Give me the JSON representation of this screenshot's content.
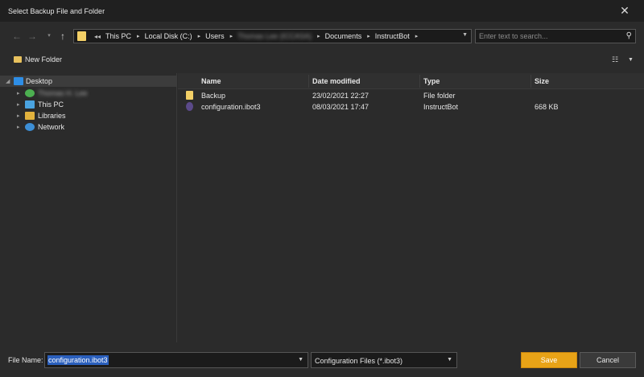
{
  "window": {
    "title": "Select Backup File and Folder"
  },
  "nav": {
    "back": "←",
    "forward": "→",
    "recent": "▾",
    "up": "↑"
  },
  "address": {
    "crumbs": [
      "This PC",
      "Local Disk (C:)",
      "Users",
      "Thomas Lee (ICCASA)",
      "Documents",
      "InstructBot"
    ]
  },
  "search": {
    "placeholder": "Enter text to search..."
  },
  "toolbar": {
    "new_folder": "New Folder"
  },
  "tree": {
    "items": [
      {
        "label": "Desktop",
        "icon": "desktop-icon",
        "color": "#2e8ee6"
      },
      {
        "label": "Thomas H. Lee",
        "icon": "user-icon",
        "color": "#4caf50"
      },
      {
        "label": "This PC",
        "icon": "computer-icon",
        "color": "#4aa3e0"
      },
      {
        "label": "Libraries",
        "icon": "libraries-icon",
        "color": "#e2b23d"
      },
      {
        "label": "Network",
        "icon": "network-icon",
        "color": "#3d8fd6"
      }
    ]
  },
  "files": {
    "columns": [
      "Name",
      "Date modified",
      "Type",
      "Size"
    ],
    "rows": [
      {
        "name": "Backup",
        "date": "23/02/2021 22:27",
        "type": "File folder",
        "size": "",
        "icon": "folder-icon",
        "color": "#f2cf66"
      },
      {
        "name": "configuration.ibot3",
        "date": "08/03/2021 17:47",
        "type": "InstructBot",
        "size": "668 KB",
        "icon": "ibot-file-icon",
        "color": "#5b4a8a"
      }
    ]
  },
  "bottom": {
    "file_name_label": "File Name:",
    "file_name_value": "configuration.ibot3",
    "file_type_value": "Configuration Files (*.ibot3)",
    "save_label": "Save",
    "cancel_label": "Cancel"
  }
}
